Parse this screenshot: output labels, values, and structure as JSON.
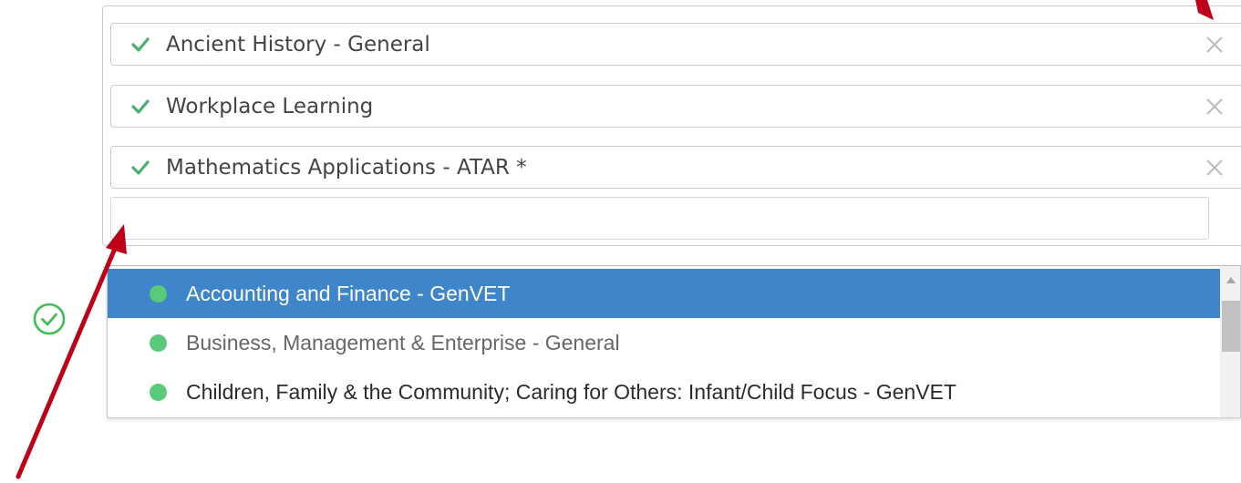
{
  "selected_items": [
    {
      "label": "Ancient History - General",
      "icon": "check-icon",
      "remove_icon": "close-icon"
    },
    {
      "label": "Workplace Learning",
      "icon": "check-icon",
      "remove_icon": "close-icon"
    },
    {
      "label": "Mathematics Applications - ATAR *",
      "icon": "check-icon",
      "remove_icon": "close-icon"
    }
  ],
  "search": {
    "value": "",
    "placeholder": ""
  },
  "status_icon": "circle-check-icon",
  "dropdown": {
    "options": [
      {
        "label": "Accounting and Finance - GenVET",
        "highlighted": true
      },
      {
        "label": "Business, Management & Enterprise - General",
        "highlighted": false
      },
      {
        "label": "Children, Family & the Community; Caring for Others: Infant/Child Focus - GenVET",
        "highlighted": false
      }
    ]
  },
  "colors": {
    "accent": "#3f85c9",
    "check": "#4caf72",
    "dot": "#59c97a",
    "annotation_arrow": "#c00018"
  }
}
